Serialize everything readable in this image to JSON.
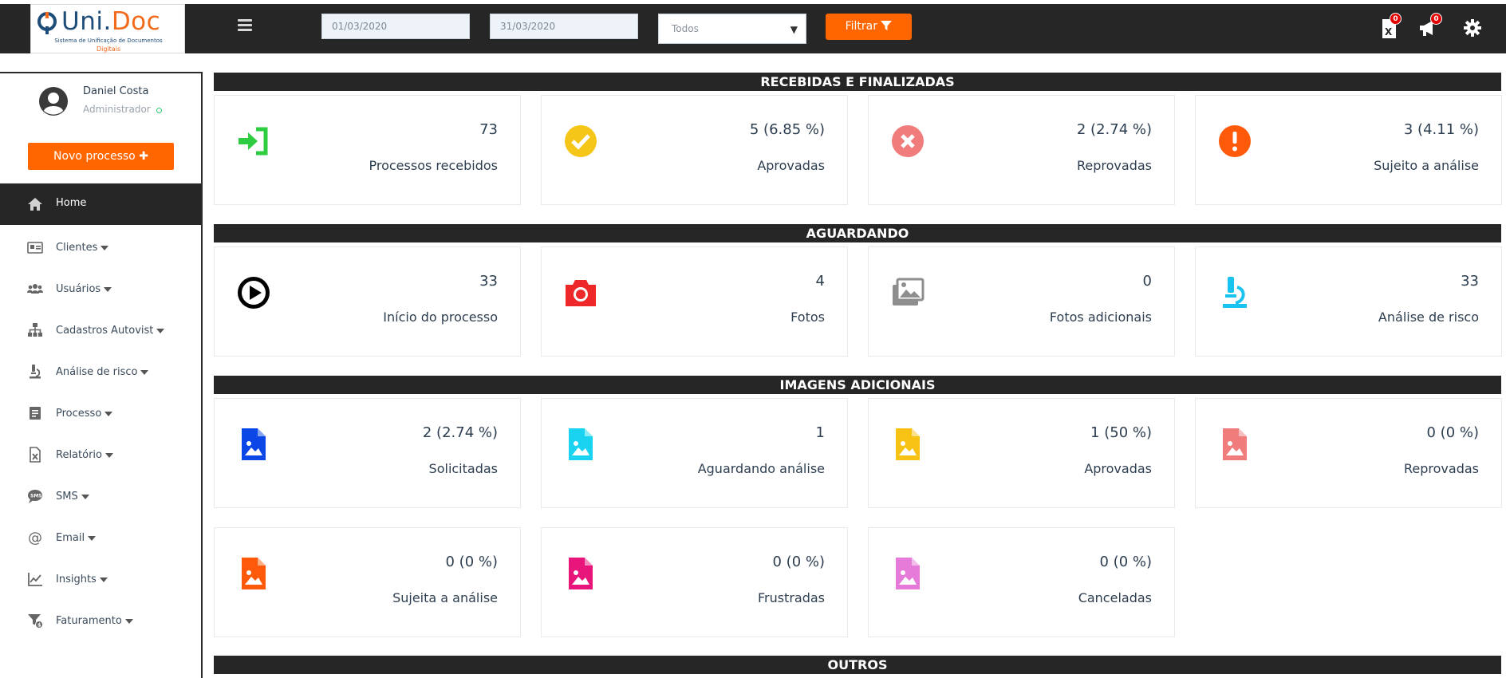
{
  "header": {
    "logo": {
      "title_a": "Uni.",
      "title_b": "Doc",
      "subtitle": "Sistema de Unificação de Documentos",
      "subtitle2": "Digitais"
    },
    "date_start": "01/03/2020",
    "date_end": "31/03/2020",
    "select_value": "Todos",
    "filter_label": "Filtrar",
    "icons": [
      {
        "name": "excel-icon",
        "badge": "0"
      },
      {
        "name": "megaphone-icon",
        "badge": "0"
      },
      {
        "name": "gear-icon"
      }
    ]
  },
  "sidebar": {
    "user_name": "Daniel Costa",
    "user_role": "Administrador",
    "new_process_label": "Novo processo",
    "home_label": "Home",
    "items": [
      {
        "label": "Clientes",
        "icon": "id-card-icon"
      },
      {
        "label": "Usuários",
        "icon": "users-icon"
      },
      {
        "label": "Cadastros Autovist",
        "icon": "sitemap-icon"
      },
      {
        "label": "Análise de risco",
        "icon": "microscope-icon"
      },
      {
        "label": "Processo",
        "icon": "document-icon"
      },
      {
        "label": "Relatório",
        "icon": "excel-file-icon"
      },
      {
        "label": "SMS",
        "icon": "sms-icon"
      },
      {
        "label": "Email",
        "icon": "at-icon"
      },
      {
        "label": "Insights",
        "icon": "chart-line-icon"
      },
      {
        "label": "Faturamento",
        "icon": "filter-dollar-icon"
      }
    ]
  },
  "sections": {
    "received": "RECEBIDAS E FINALIZADAS",
    "waiting": "AGUARDANDO",
    "images": "IMAGENS ADICIONAIS",
    "others": "OUTROS"
  },
  "cards_received": [
    {
      "value": "73",
      "label": "Processos recebidos",
      "icon": "sign-in-icon",
      "color": "#2ecc40"
    },
    {
      "value": "5 (6.85 %)",
      "label": "Aprovadas",
      "icon": "check-circle-icon",
      "color": "#f5c518"
    },
    {
      "value": "2 (2.74 %)",
      "label": "Reprovadas",
      "icon": "times-circle-icon",
      "color": "#f07c7c"
    },
    {
      "value": "3 (4.11 %)",
      "label": "Sujeito a análise",
      "icon": "exclamation-circle-icon",
      "color": "#ff5a0a"
    }
  ],
  "cards_waiting": [
    {
      "value": "33",
      "label": "Início do processo",
      "icon": "play-circle-icon",
      "color": "#000000"
    },
    {
      "value": "4",
      "label": "Fotos",
      "icon": "camera-icon",
      "color": "#ee2828"
    },
    {
      "value": "0",
      "label": "Fotos adicionais",
      "icon": "images-icon",
      "color": "#8e8e8e"
    },
    {
      "value": "33",
      "label": "Análise de risco",
      "icon": "microscope-icon",
      "color": "#19c3f0"
    }
  ],
  "cards_images": [
    {
      "value": "2 (2.74 %)",
      "label": "Solicitadas",
      "icon": "file-image-icon",
      "color": "#0a47e6"
    },
    {
      "value": "1",
      "label": "Aguardando análise",
      "icon": "file-image-icon",
      "color": "#19d3f0"
    },
    {
      "value": "1 (50 %)",
      "label": "Aprovadas",
      "icon": "file-image-icon",
      "color": "#f7c213"
    },
    {
      "value": "0 (0 %)",
      "label": "Reprovadas",
      "icon": "file-image-icon",
      "color": "#f07c7c"
    },
    {
      "value": "0 (0 %)",
      "label": "Sujeita a análise",
      "icon": "file-image-icon",
      "color": "#ff5a0a"
    },
    {
      "value": "0 (0 %)",
      "label": "Frustradas",
      "icon": "file-image-icon",
      "color": "#e8157a"
    },
    {
      "value": "0 (0 %)",
      "label": "Canceladas",
      "icon": "file-image-icon",
      "color": "#e67ad8"
    }
  ]
}
